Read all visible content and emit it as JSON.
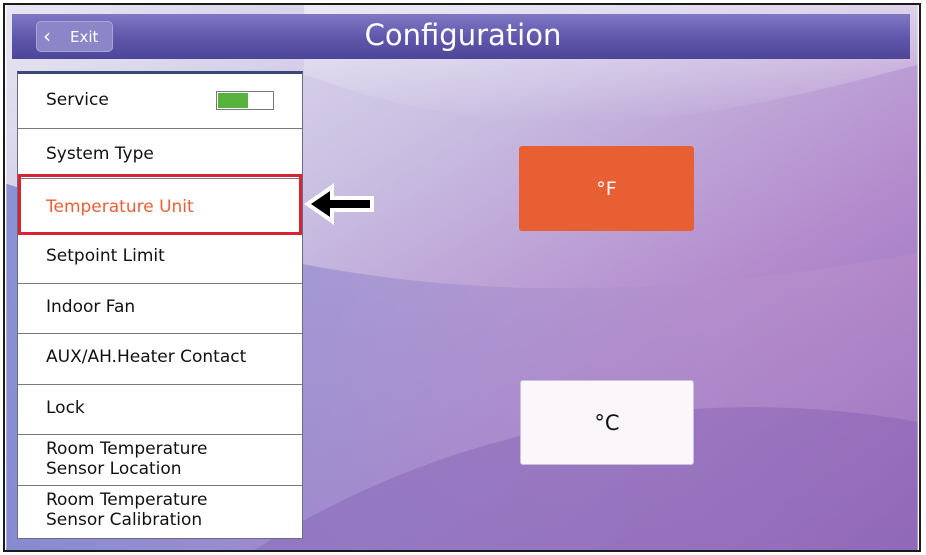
{
  "header": {
    "title": "Configuration",
    "exit_label": "Exit"
  },
  "menu": {
    "items": [
      {
        "label": "Service",
        "toggle": true
      },
      {
        "label": "System Type"
      },
      {
        "label": "Temperature Unit",
        "selected": true
      },
      {
        "label": "Setpoint Limit"
      },
      {
        "label": "Indoor Fan"
      },
      {
        "label": "AUX/AH.Heater Contact"
      },
      {
        "label": "Lock"
      },
      {
        "label_lines": [
          "Room Temperature",
          "Sensor Location"
        ]
      },
      {
        "label_lines": [
          "Room Temperature",
          "Sensor Calibration"
        ]
      }
    ]
  },
  "units": {
    "fahrenheit_label": "°F",
    "celsius_label": "°C",
    "selected": "fahrenheit"
  },
  "colors": {
    "selected_text": "#e85f34",
    "fahrenheit_button": "#e85f34",
    "highlight_border": "#d7242f",
    "toggle_on": "#58b33e",
    "header": "#5e56aa"
  }
}
